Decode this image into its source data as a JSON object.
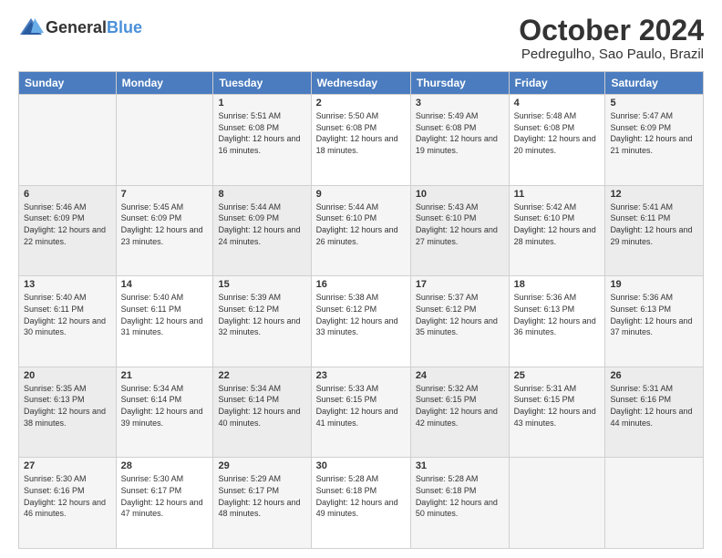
{
  "header": {
    "logo_general": "General",
    "logo_blue": "Blue",
    "title": "October 2024",
    "subtitle": "Pedregulho, Sao Paulo, Brazil"
  },
  "weekdays": [
    "Sunday",
    "Monday",
    "Tuesday",
    "Wednesday",
    "Thursday",
    "Friday",
    "Saturday"
  ],
  "weeks": [
    [
      {
        "day": "",
        "info": ""
      },
      {
        "day": "",
        "info": ""
      },
      {
        "day": "1",
        "info": "Sunrise: 5:51 AM\nSunset: 6:08 PM\nDaylight: 12 hours and 16 minutes."
      },
      {
        "day": "2",
        "info": "Sunrise: 5:50 AM\nSunset: 6:08 PM\nDaylight: 12 hours and 18 minutes."
      },
      {
        "day": "3",
        "info": "Sunrise: 5:49 AM\nSunset: 6:08 PM\nDaylight: 12 hours and 19 minutes."
      },
      {
        "day": "4",
        "info": "Sunrise: 5:48 AM\nSunset: 6:08 PM\nDaylight: 12 hours and 20 minutes."
      },
      {
        "day": "5",
        "info": "Sunrise: 5:47 AM\nSunset: 6:09 PM\nDaylight: 12 hours and 21 minutes."
      }
    ],
    [
      {
        "day": "6",
        "info": "Sunrise: 5:46 AM\nSunset: 6:09 PM\nDaylight: 12 hours and 22 minutes."
      },
      {
        "day": "7",
        "info": "Sunrise: 5:45 AM\nSunset: 6:09 PM\nDaylight: 12 hours and 23 minutes."
      },
      {
        "day": "8",
        "info": "Sunrise: 5:44 AM\nSunset: 6:09 PM\nDaylight: 12 hours and 24 minutes."
      },
      {
        "day": "9",
        "info": "Sunrise: 5:44 AM\nSunset: 6:10 PM\nDaylight: 12 hours and 26 minutes."
      },
      {
        "day": "10",
        "info": "Sunrise: 5:43 AM\nSunset: 6:10 PM\nDaylight: 12 hours and 27 minutes."
      },
      {
        "day": "11",
        "info": "Sunrise: 5:42 AM\nSunset: 6:10 PM\nDaylight: 12 hours and 28 minutes."
      },
      {
        "day": "12",
        "info": "Sunrise: 5:41 AM\nSunset: 6:11 PM\nDaylight: 12 hours and 29 minutes."
      }
    ],
    [
      {
        "day": "13",
        "info": "Sunrise: 5:40 AM\nSunset: 6:11 PM\nDaylight: 12 hours and 30 minutes."
      },
      {
        "day": "14",
        "info": "Sunrise: 5:40 AM\nSunset: 6:11 PM\nDaylight: 12 hours and 31 minutes."
      },
      {
        "day": "15",
        "info": "Sunrise: 5:39 AM\nSunset: 6:12 PM\nDaylight: 12 hours and 32 minutes."
      },
      {
        "day": "16",
        "info": "Sunrise: 5:38 AM\nSunset: 6:12 PM\nDaylight: 12 hours and 33 minutes."
      },
      {
        "day": "17",
        "info": "Sunrise: 5:37 AM\nSunset: 6:12 PM\nDaylight: 12 hours and 35 minutes."
      },
      {
        "day": "18",
        "info": "Sunrise: 5:36 AM\nSunset: 6:13 PM\nDaylight: 12 hours and 36 minutes."
      },
      {
        "day": "19",
        "info": "Sunrise: 5:36 AM\nSunset: 6:13 PM\nDaylight: 12 hours and 37 minutes."
      }
    ],
    [
      {
        "day": "20",
        "info": "Sunrise: 5:35 AM\nSunset: 6:13 PM\nDaylight: 12 hours and 38 minutes."
      },
      {
        "day": "21",
        "info": "Sunrise: 5:34 AM\nSunset: 6:14 PM\nDaylight: 12 hours and 39 minutes."
      },
      {
        "day": "22",
        "info": "Sunrise: 5:34 AM\nSunset: 6:14 PM\nDaylight: 12 hours and 40 minutes."
      },
      {
        "day": "23",
        "info": "Sunrise: 5:33 AM\nSunset: 6:15 PM\nDaylight: 12 hours and 41 minutes."
      },
      {
        "day": "24",
        "info": "Sunrise: 5:32 AM\nSunset: 6:15 PM\nDaylight: 12 hours and 42 minutes."
      },
      {
        "day": "25",
        "info": "Sunrise: 5:31 AM\nSunset: 6:15 PM\nDaylight: 12 hours and 43 minutes."
      },
      {
        "day": "26",
        "info": "Sunrise: 5:31 AM\nSunset: 6:16 PM\nDaylight: 12 hours and 44 minutes."
      }
    ],
    [
      {
        "day": "27",
        "info": "Sunrise: 5:30 AM\nSunset: 6:16 PM\nDaylight: 12 hours and 46 minutes."
      },
      {
        "day": "28",
        "info": "Sunrise: 5:30 AM\nSunset: 6:17 PM\nDaylight: 12 hours and 47 minutes."
      },
      {
        "day": "29",
        "info": "Sunrise: 5:29 AM\nSunset: 6:17 PM\nDaylight: 12 hours and 48 minutes."
      },
      {
        "day": "30",
        "info": "Sunrise: 5:28 AM\nSunset: 6:18 PM\nDaylight: 12 hours and 49 minutes."
      },
      {
        "day": "31",
        "info": "Sunrise: 5:28 AM\nSunset: 6:18 PM\nDaylight: 12 hours and 50 minutes."
      },
      {
        "day": "",
        "info": ""
      },
      {
        "day": "",
        "info": ""
      }
    ]
  ]
}
